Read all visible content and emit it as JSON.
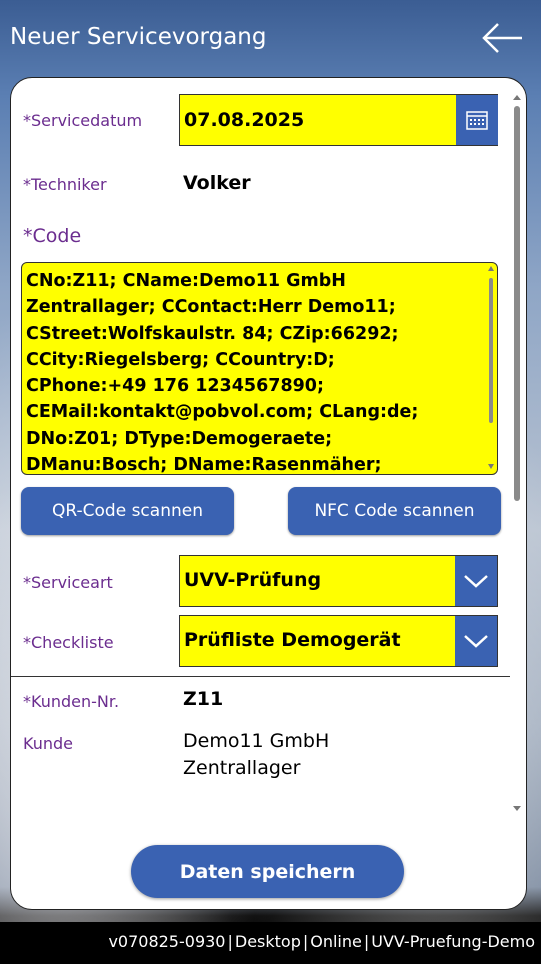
{
  "header": {
    "title": "Neuer Servicevorgang",
    "back_icon": "arrow-left-icon"
  },
  "form": {
    "servicedatum_label": "*Servicedatum",
    "servicedatum_value": "07.08.2025",
    "calendar_icon": "calendar-icon",
    "techniker_label": "*Techniker",
    "techniker_value": "Volker",
    "code_label": "*Code",
    "code_lines": [
      "CNo:Z11; CName:Demo11 GmbH",
      "Zentrallager; CContact:Herr Demo11;",
      "CStreet:Wolfskaulstr. 84; CZip:66292;",
      "CCity:Riegelsberg; CCountry:D;",
      "CPhone:+49 176 1234567890;",
      "CEMail:kontakt@pobvol.com; CLang:de;",
      "DNo:Z01; DType:Demogeraete;",
      "DManu:Bosch; DName:Rasenmäher;"
    ],
    "qr_button": "QR-Code scannen",
    "nfc_button": "NFC Code scannen",
    "serviceart_label": "*Serviceart",
    "serviceart_value": "UVV-Prüfung",
    "checkliste_label": "*Checkliste",
    "checkliste_value": "Prüfliste Demogerät",
    "kunden_nr_label": "*Kunden-Nr.",
    "kunden_nr_value": "Z11",
    "kunde_label": "Kunde",
    "kunde_line1": "Demo11 GmbH",
    "kunde_line2": "Zentrallager",
    "save_button": "Daten speichern"
  },
  "footer": {
    "version": "v070825-0930",
    "platform": "Desktop",
    "status": "Online",
    "app": "UVV-Pruefung-Demo",
    "separator": "|"
  },
  "colors": {
    "accent": "#3a62b2",
    "highlight": "#ffff00",
    "label": "#6b2d8f"
  }
}
